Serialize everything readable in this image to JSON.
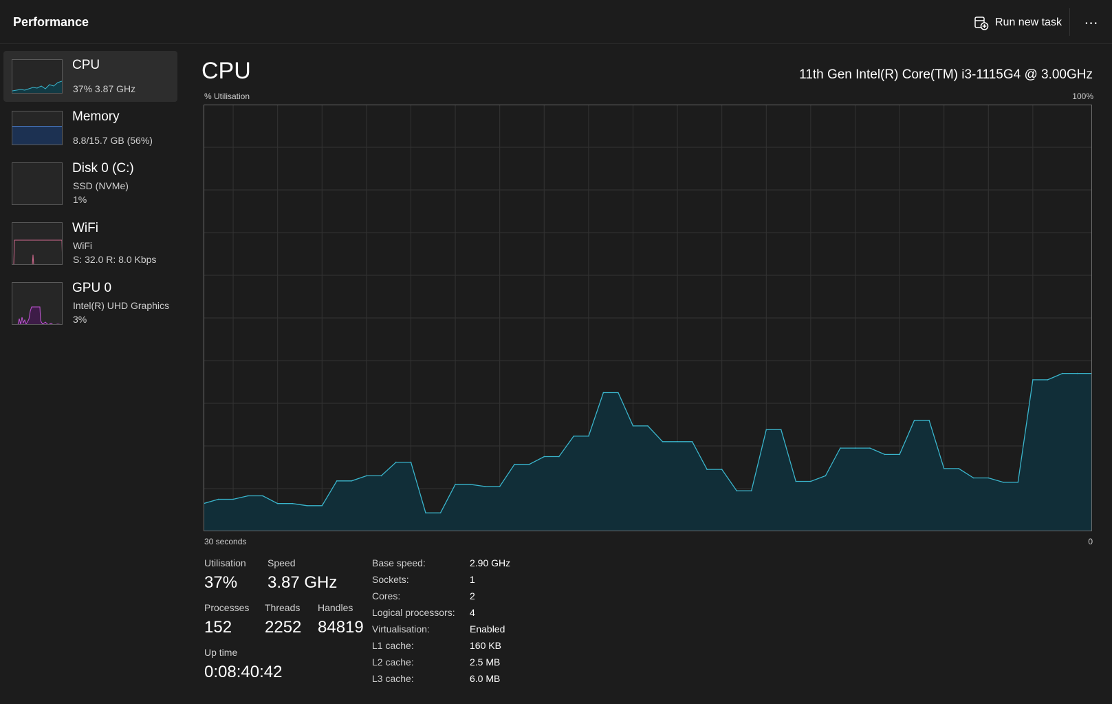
{
  "header": {
    "title": "Performance",
    "run_task_label": "Run new task",
    "more_label": "⋯"
  },
  "sidebar": {
    "items": [
      {
        "name": "CPU",
        "sub1": "37%  3.87 GHz",
        "sub2": "",
        "color": "#3ab5cc",
        "active": true
      },
      {
        "name": "Memory",
        "sub1": "8.8/15.7 GB (56%)",
        "sub2": "",
        "color": "#4a78c0",
        "active": false
      },
      {
        "name": "Disk 0 (C:)",
        "sub1": "SSD (NVMe)",
        "sub2": "1%",
        "color": "#5aa55a",
        "active": false
      },
      {
        "name": "WiFi",
        "sub1": "WiFi",
        "sub2": "S: 32.0  R: 8.0 Kbps",
        "color": "#d06a8e",
        "active": false
      },
      {
        "name": "GPU 0",
        "sub1": "Intel(R) UHD Graphics",
        "sub2": "3%",
        "color": "#c257d6",
        "active": false
      }
    ]
  },
  "main": {
    "title": "CPU",
    "model": "11th Gen Intel(R) Core(TM) i3-1115G4 @ 3.00GHz",
    "y_label": "% Utilisation",
    "y_max_label": "100%",
    "x_left_label": "30 seconds",
    "x_right_label": "0"
  },
  "stats": {
    "utilisation_label": "Utilisation",
    "utilisation": "37%",
    "speed_label": "Speed",
    "speed": "3.87 GHz",
    "processes_label": "Processes",
    "processes": "152",
    "threads_label": "Threads",
    "threads": "2252",
    "handles_label": "Handles",
    "handles": "84819",
    "uptime_label": "Up time",
    "uptime": "0:08:40:42"
  },
  "specs": [
    {
      "key": "Base speed:",
      "value": "2.90 GHz"
    },
    {
      "key": "Sockets:",
      "value": "1"
    },
    {
      "key": "Cores:",
      "value": "2"
    },
    {
      "key": "Logical processors:",
      "value": "4"
    },
    {
      "key": "Virtualisation:",
      "value": "Enabled"
    },
    {
      "key": "L1 cache:",
      "value": "160 KB"
    },
    {
      "key": "L2 cache:",
      "value": "2.5 MB"
    },
    {
      "key": "L3 cache:",
      "value": "6.0 MB"
    }
  ],
  "colors": {
    "background": "#1c1c1c",
    "cpu_line": "#3ab5cc",
    "cpu_fill": "#112e38",
    "grid": "#333333"
  },
  "chart_data": {
    "type": "area",
    "title": "",
    "xlabel": "",
    "ylabel": "% Utilisation",
    "ylim": [
      0,
      100
    ],
    "xlim": [
      30,
      0
    ],
    "grid": true,
    "series": [
      {
        "name": "",
        "x": [
          30,
          29.5,
          29,
          28.5,
          28,
          27.5,
          27,
          26.5,
          26,
          25.5,
          25,
          24.5,
          24,
          23.5,
          23,
          22.5,
          22,
          21.5,
          21,
          20.5,
          20,
          19.5,
          19,
          18.5,
          18,
          17.5,
          17,
          16.5,
          16,
          15.5,
          15,
          14.5,
          14,
          13.5,
          13,
          12.5,
          12,
          11.5,
          11,
          10.5,
          10,
          9.5,
          9,
          8.5,
          8,
          7.5,
          7,
          6.5,
          6,
          5.5,
          5,
          4.5,
          4,
          3.5,
          3,
          2.5,
          2,
          1.5,
          1,
          0.5,
          0
        ],
        "values": [
          6.5,
          7.5,
          7.5,
          8.3,
          8.3,
          6.5,
          6.5,
          6,
          6,
          11.8,
          11.8,
          13,
          13,
          16.2,
          16.2,
          4.3,
          4.3,
          11,
          11,
          10.5,
          10.5,
          15.7,
          15.7,
          17.5,
          17.5,
          22.3,
          22.3,
          32.5,
          32.5,
          24.7,
          24.7,
          21,
          21,
          21,
          14.5,
          14.5,
          9.5,
          9.5,
          23.8,
          23.8,
          11.7,
          11.7,
          13,
          19.5,
          19.5,
          19.5,
          18,
          18,
          26,
          26,
          14.7,
          14.7,
          12.5,
          12.5,
          11.5,
          11.5,
          35.5,
          35.5,
          37,
          37,
          37
        ]
      }
    ]
  }
}
